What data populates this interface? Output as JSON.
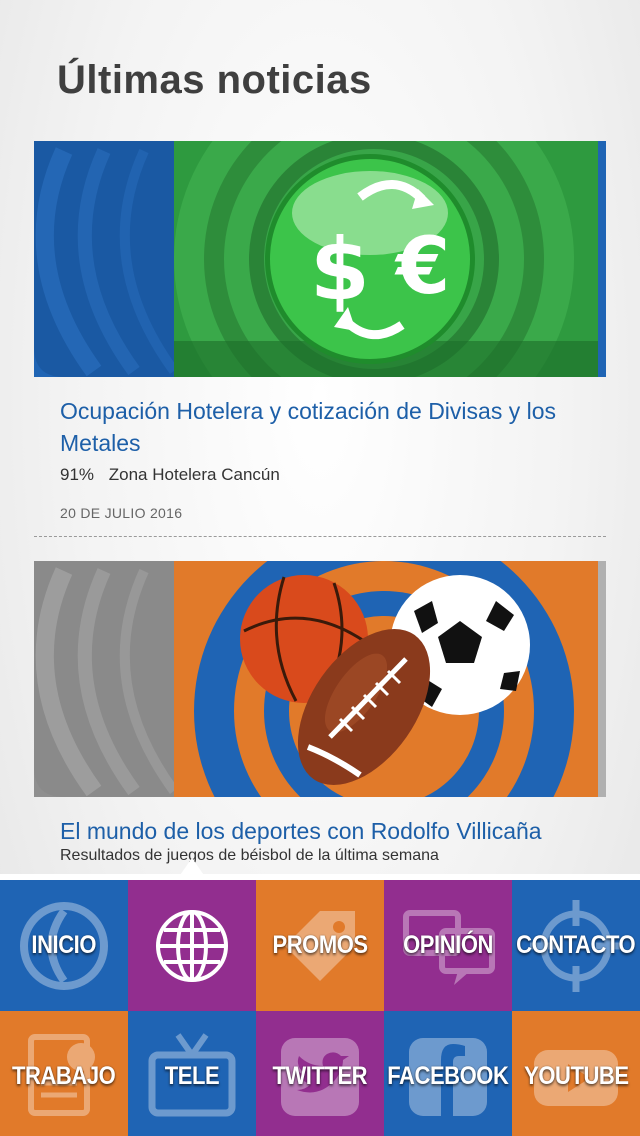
{
  "header": {
    "title": "Últimas noticias"
  },
  "articles": [
    {
      "title": "Ocupación Hotelera y cotización de Divisas y los Metales",
      "excerpt_value": "91%",
      "excerpt_text": "Zona Hotelera Cancún",
      "date": "20 DE JULIO 2016",
      "image_icon": "currency-exchange-icon"
    },
    {
      "title": "El mundo de los deportes con Rodolfo Villicaña",
      "excerpt_text": "Resultados de juegos de béisbol de la última semana",
      "image_icon": "sports-balls-icon"
    }
  ],
  "nav": {
    "items": [
      {
        "label": "INICIO",
        "icon": "home-logo-icon",
        "color": "#1f64b4"
      },
      {
        "label": "",
        "icon": "globe-icon",
        "color": "#922e8f",
        "active": true
      },
      {
        "label": "PROMOS",
        "icon": "tag-icon",
        "color": "#e17a2a"
      },
      {
        "label": "OPINIÓN",
        "icon": "speech-bubbles-icon",
        "color": "#922e8f"
      },
      {
        "label": "CONTACTO",
        "icon": "crosshair-icon",
        "color": "#1f64b4"
      },
      {
        "label": "TRABAJO",
        "icon": "resume-icon",
        "color": "#e17a2a"
      },
      {
        "label": "TELE",
        "icon": "tv-icon",
        "color": "#1f64b4"
      },
      {
        "label": "TWITTER",
        "icon": "twitter-icon",
        "color": "#922e8f"
      },
      {
        "label": "FACEBOOK",
        "icon": "facebook-icon",
        "color": "#1f64b4"
      },
      {
        "label": "YOUTUBE",
        "icon": "youtube-icon",
        "color": "#e17a2a"
      }
    ]
  },
  "colors": {
    "blue": "#1f64b4",
    "purple": "#922e8f",
    "orange": "#e17a2a",
    "link": "#1d5fa8",
    "green": "#2a9d3a"
  }
}
